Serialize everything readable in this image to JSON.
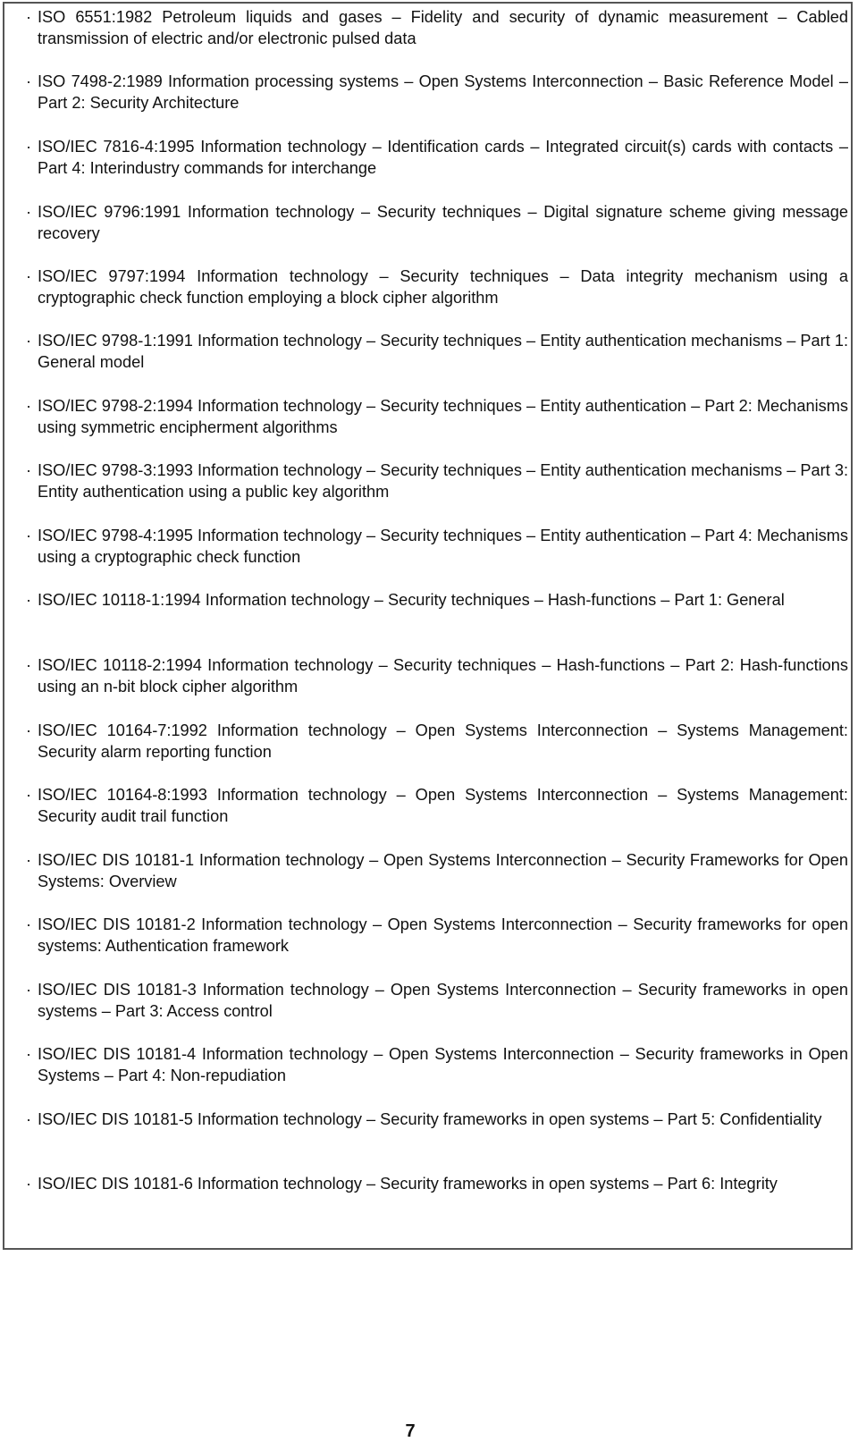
{
  "references": [
    {
      "bullet": "·",
      "text": "ISO 6551:1982 Petroleum liquids and gases –  Fidelity and security of dynamic measurement – Cabled transmission of electric and/or electronic pulsed data"
    },
    {
      "bullet": "·",
      "text": "ISO 7498-2:1989 Information processing systems –  Open Systems Interconnection –  Basic Reference Model –  Part 2: Security Architecture"
    },
    {
      "bullet": "·",
      "text": "ISO/IEC 7816-4:1995 Information technology –  Identification cards – Integrated circuit(s) cards with contacts –  Part 4: Interindustry commands for interchange"
    },
    {
      "bullet": "·",
      "text": "ISO/IEC 9796:1991 Information technology –  Security techniques –  Digital signature scheme giving message recovery"
    },
    {
      "bullet": "·",
      "text": "ISO/IEC 9797:1994 Information technology –  Security techniques –  Data integrity mechanism using a cryptographic check function employing a block cipher algorithm"
    },
    {
      "bullet": "·",
      "text": "ISO/IEC 9798-1:1991 Information technology –  Security techniques –  Entity authentication mechanisms –  Part 1: General model"
    },
    {
      "bullet": "·",
      "text": "ISO/IEC 9798-2:1994 Information technology –  Security techniques –  Entity authentication –  Part 2: Mechanisms using symmetric encipherment algorithms"
    },
    {
      "bullet": "·",
      "text": "ISO/IEC 9798-3:1993 Information technology –  Security techniques –  Entity authentication mechanisms –  Part 3: Entity authentication using a public key algorithm"
    },
    {
      "bullet": "·",
      "text": "ISO/IEC 9798-4:1995 Information technology –  Security techniques – Entity authentication –  Part 4: Mechanisms using a cryptographic check function"
    },
    {
      "bullet": "·",
      "text": "ISO/IEC 10118-1:1994 Information technology –  Security techniques –  Hash-functions –  Part 1: General"
    },
    {
      "bullet": "·",
      "text": "ISO/IEC 10118-2:1994 Information technology –  Security techniques –  Hash-functions –  Part 2: Hash-functions using an n-bit block cipher algorithm"
    },
    {
      "bullet": "·",
      "text": "ISO/IEC 10164-7:1992 Information technology –  Open Systems Interconnection –  Systems Management: Security alarm reporting function"
    },
    {
      "bullet": "·",
      "text": "ISO/IEC 10164-8:1993 Information technology –  Open Systems Interconnection –  Systems Management: Security audit trail function"
    },
    {
      "bullet": "·",
      "text": "ISO/IEC DIS 10181-1 Information technology –  Open Systems Interconnection –  Security Frameworks for Open Systems: Overview"
    },
    {
      "bullet": "·",
      "text": "ISO/IEC DIS 10181-2 Information technology –  Open Systems Interconnection –  Security frameworks for open systems: Authentication framework"
    },
    {
      "bullet": "·",
      "text": "ISO/IEC DIS 10181-3 Information technology –  Open Systems Interconnection –  Security frameworks in open systems – Part 3: Access control"
    },
    {
      "bullet": "·",
      "text": "ISO/IEC DIS 10181-4 Information technology –  Open Systems Interconnection –  Security frameworks in Open Systems –  Part 4: Non-repudiation"
    },
    {
      "bullet": "·",
      "text": "ISO/IEC DIS 10181-5 Information technology –  Security frameworks in open systems –  Part 5: Confidentiality"
    },
    {
      "bullet": "·",
      "text": "ISO/IEC DIS 10181-6 Information technology –  Security frameworks in open systems –  Part 6: Integrity"
    }
  ],
  "page_number": "7"
}
